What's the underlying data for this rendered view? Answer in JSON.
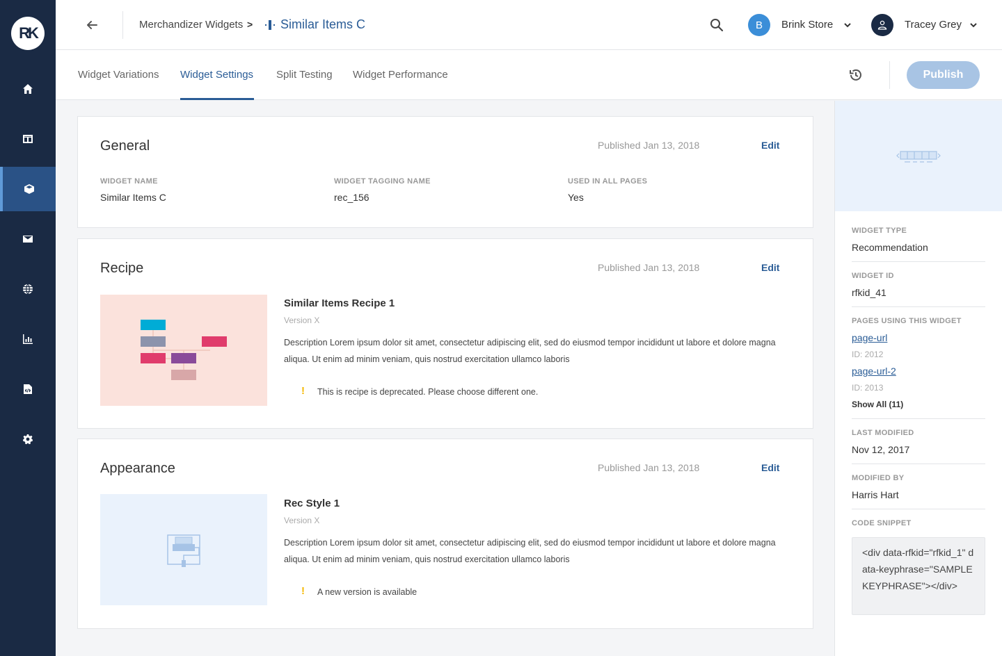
{
  "app": {
    "logo_text": "RK"
  },
  "sidebar": {
    "items": [
      {
        "icon": "home-icon"
      },
      {
        "icon": "layout-icon"
      },
      {
        "icon": "cube-icon",
        "active": true
      },
      {
        "icon": "mail-icon"
      },
      {
        "icon": "globe-icon"
      },
      {
        "icon": "chart-icon"
      },
      {
        "icon": "code-file-icon"
      },
      {
        "icon": "gear-icon"
      }
    ]
  },
  "header": {
    "breadcrumb_parent": "Merchandizer Widgets",
    "breadcrumb_separator": ">",
    "breadcrumb_current": "Similar Items C",
    "store_initial": "B",
    "store_name": "Brink Store",
    "user_name": "Tracey Grey"
  },
  "tabs": [
    {
      "label": "Widget Variations"
    },
    {
      "label": "Widget Settings",
      "active": true
    },
    {
      "label": "Split Testing"
    },
    {
      "label": "Widget Performance"
    }
  ],
  "publish_label": "Publish",
  "general": {
    "title": "General",
    "published": "Published Jan 13, 2018",
    "edit": "Edit",
    "fields": [
      {
        "label": "WIDGET NAME",
        "value": "Similar Items C"
      },
      {
        "label": "WIDGET TAGGING NAME",
        "value": "rec_156"
      },
      {
        "label": "USED IN ALL PAGES",
        "value": "Yes"
      }
    ]
  },
  "recipe": {
    "title": "Recipe",
    "published": "Published Jan 13, 2018",
    "edit": "Edit",
    "item_title": "Similar Items Recipe 1",
    "version": "Version X",
    "description": "Description Lorem ipsum dolor sit amet, consectetur adipiscing elit, sed do eiusmod tempor incididunt ut labore et dolore magna aliqua. Ut enim ad minim veniam, quis nostrud exercitation ullamco laboris",
    "warning_icon": "!",
    "warning": "This is recipe is deprecated. Please choose different one."
  },
  "appearance": {
    "title": "Appearance",
    "published": "Published Jan 13, 2018",
    "edit": "Edit",
    "item_title": "Rec Style 1",
    "version": "Version X",
    "description": "Description Lorem ipsum dolor sit amet, consectetur adipiscing elit, sed do eiusmod tempor incididunt ut labore et dolore magna aliqua. Ut enim ad minim veniam, quis nostrud exercitation ullamco laboris",
    "warning_icon": "!",
    "warning": "A new version is available"
  },
  "details": {
    "widget_type_label": "WIDGET TYPE",
    "widget_type": "Recommendation",
    "widget_id_label": "WIDGET ID",
    "widget_id": "rfkid_41",
    "pages_label": "PAGES USING THIS WIDGET",
    "pages": [
      {
        "url": "page-url",
        "id": "ID: 2012"
      },
      {
        "url": "page-url-2",
        "id": "ID: 2013"
      }
    ],
    "show_all": "Show All (11)",
    "last_modified_label": "LAST MODIFIED",
    "last_modified": "Nov 12, 2017",
    "modified_by_label": "MODIFIED BY",
    "modified_by": "Harris Hart",
    "code_snippet_label": "CODE SNIPPET",
    "code_snippet": "<div data-rfkid=\"rfkid_1\" data-keyphrase=\"SAMPLE KEYPHRASE\"></div>"
  },
  "colors": {
    "sidebar_bg": "#1a2a44",
    "accent": "#2a5c96",
    "publish_disabled": "#a8c4e4",
    "warning": "#f5b800"
  }
}
